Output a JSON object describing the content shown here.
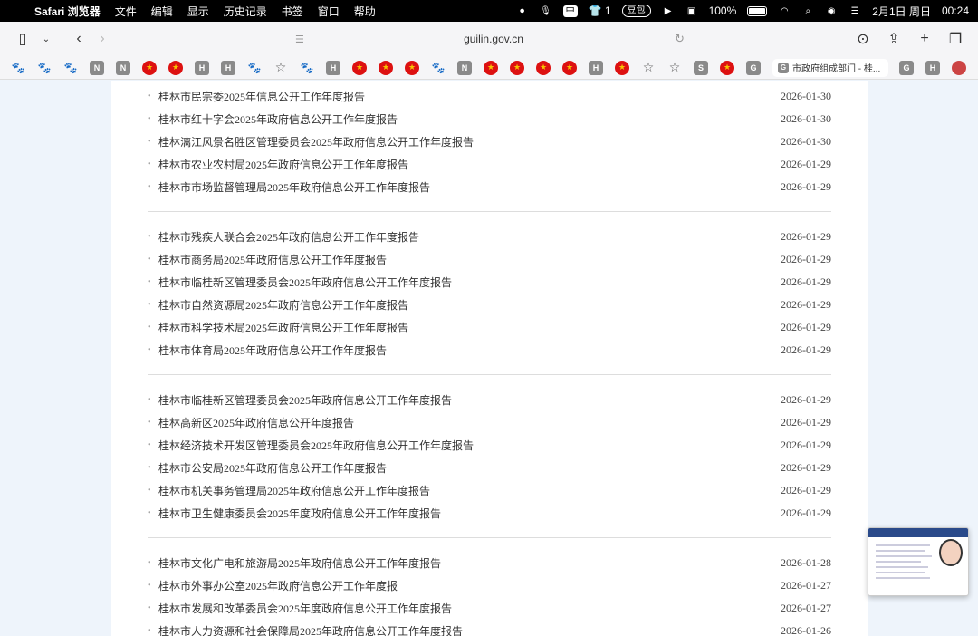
{
  "menubar": {
    "app_name": "Safari 浏览器",
    "menus": [
      "文件",
      "编辑",
      "显示",
      "历史记录",
      "书签",
      "窗口",
      "帮助"
    ],
    "input_method": "中",
    "shirt_count": "1",
    "doubao": "豆包",
    "battery": "100%",
    "date": "2月1日 周日",
    "time": "00:24"
  },
  "toolbar": {
    "url": "guilin.gov.cn"
  },
  "favorites": {
    "tab_title": "市政府组成部门 - 桂..."
  },
  "news_groups": [
    {
      "items": [
        {
          "title": "桂林市民宗委2025年信息公开工作年度报告",
          "date": "2026-01-30"
        },
        {
          "title": "桂林市红十字会2025年政府信息公开工作年度报告",
          "date": "2026-01-30"
        },
        {
          "title": "桂林漓江风景名胜区管理委员会2025年政府信息公开工作年度报告",
          "date": "2026-01-30"
        },
        {
          "title": "桂林市农业农村局2025年政府信息公开工作年度报告",
          "date": "2026-01-29"
        },
        {
          "title": "桂林市市场监督管理局2025年政府信息公开工作年度报告",
          "date": "2026-01-29"
        }
      ]
    },
    {
      "items": [
        {
          "title": "桂林市残疾人联合会2025年政府信息公开工作年度报告",
          "date": "2026-01-29"
        },
        {
          "title": "桂林市商务局2025年政府信息公开工作年度报告",
          "date": "2026-01-29"
        },
        {
          "title": "桂林市临桂新区管理委员会2025年政府信息公开工作年度报告",
          "date": "2026-01-29"
        },
        {
          "title": "桂林市自然资源局2025年政府信息公开工作年度报告",
          "date": "2026-01-29"
        },
        {
          "title": "桂林市科学技术局2025年政府信息公开工作年度报告",
          "date": "2026-01-29"
        },
        {
          "title": "桂林市体育局2025年政府信息公开工作年度报告",
          "date": "2026-01-29"
        }
      ]
    },
    {
      "items": [
        {
          "title": "桂林市临桂新区管理委员会2025年政府信息公开工作年度报告",
          "date": "2026-01-29"
        },
        {
          "title": "桂林高新区2025年政府信息公开年度报告",
          "date": "2026-01-29"
        },
        {
          "title": "桂林经济技术开发区管理委员会2025年政府信息公开工作年度报告",
          "date": "2026-01-29"
        },
        {
          "title": "桂林市公安局2025年政府信息公开工作年度报告",
          "date": "2026-01-29"
        },
        {
          "title": "桂林市机关事务管理局2025年政府信息公开工作年度报告",
          "date": "2026-01-29"
        },
        {
          "title": "桂林市卫生健康委员会2025年度政府信息公开工作年度报告",
          "date": "2026-01-29"
        }
      ]
    },
    {
      "items": [
        {
          "title": "桂林市文化广电和旅游局2025年政府信息公开工作年度报告",
          "date": "2026-01-28"
        },
        {
          "title": "桂林市外事办公室2025年政府信息公开工作年度报",
          "date": "2026-01-27"
        },
        {
          "title": "桂林市发展和改革委员会2025年度政府信息公开工作年度报告",
          "date": "2026-01-27"
        },
        {
          "title": "桂林市人力资源和社会保障局2025年政府信息公开工作年度报告",
          "date": "2026-01-26"
        }
      ]
    }
  ]
}
